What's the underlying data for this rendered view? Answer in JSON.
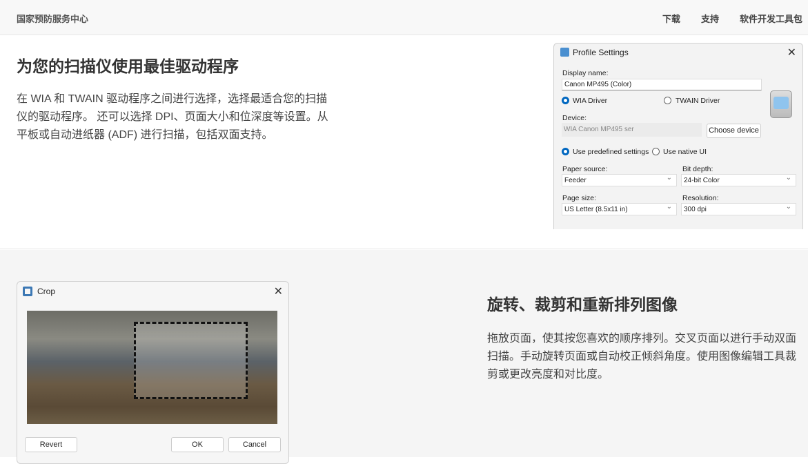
{
  "header": {
    "brand": "国家预防服务中心",
    "nav": [
      "下载",
      "支持",
      "软件开发工具包"
    ]
  },
  "section1": {
    "title": "为您的扫描仪使用最佳驱动程序",
    "text": "在 WIA 和 TWAIN 驱动程序之间进行选择，选择最适合您的扫描仪的驱动程序。 还可以选择 DPI、页面大小和位深度等设置。从平板或自动进纸器 (ADF) 进行扫描，包括双面支持。"
  },
  "profile": {
    "title": "Profile Settings",
    "display_name_label": "Display name:",
    "display_name": "Canon MP495 (Color)",
    "wia": "WIA Driver",
    "twain": "TWAIN Driver",
    "device_label": "Device:",
    "device": "WIA Canon MP495 ser",
    "choose_device": "Choose device",
    "predefined": "Use predefined settings",
    "native": "Use native UI",
    "paper_source_label": "Paper source:",
    "paper_source": "Feeder",
    "bit_depth_label": "Bit depth:",
    "bit_depth": "24-bit Color",
    "page_size_label": "Page size:",
    "page_size": "US Letter (8.5x11 in)",
    "resolution_label": "Resolution:",
    "resolution": "300 dpi"
  },
  "crop": {
    "title": "Crop",
    "revert": "Revert",
    "ok": "OK",
    "cancel": "Cancel"
  },
  "section2": {
    "title": "旋转、裁剪和重新排列图像",
    "text": "拖放页面，使其按您喜欢的顺序排列。交叉页面以进行手动双面扫描。手动旋转页面或自动校正倾斜角度。使用图像编辑工具裁剪或更改亮度和对比度。"
  }
}
